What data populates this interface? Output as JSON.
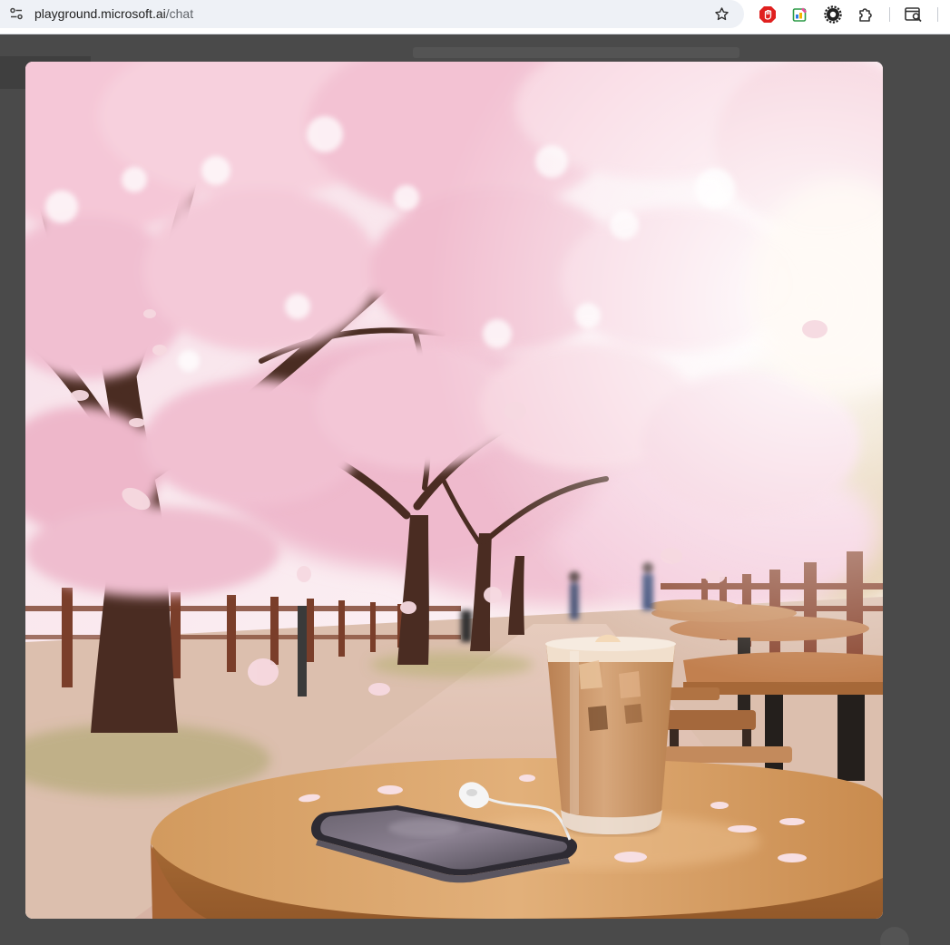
{
  "browser": {
    "url_host": "playground.microsoft.ai",
    "url_path": "/chat",
    "icons": {
      "site_info": "site-settings-icon",
      "bookmark": "star-icon",
      "extensions": [
        "adblock-extension-icon",
        "color-picker-extension-icon",
        "settings-extension-icon",
        "puzzle-extensions-icon",
        "search-tab-icon"
      ]
    }
  },
  "overlay": {
    "image_subject": "iced-coffee-cherry-blossom-scene",
    "colors": {
      "backdrop": "#4a4a4a",
      "blossom": "#f3c6d6",
      "coffee": "#c9956a",
      "table": "#c98b4e"
    }
  }
}
